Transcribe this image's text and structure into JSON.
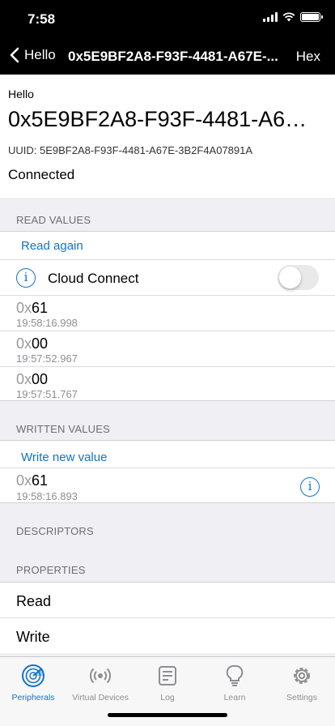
{
  "status": {
    "time": "7:58"
  },
  "nav": {
    "back_label": "Hello",
    "title": "0x5E9BF2A8-F93F-4481-A67E-...",
    "right_label": "Hex"
  },
  "header": {
    "peripheral_name": "Hello",
    "characteristic_title": "0x5E9BF2A8-F93F-4481-A6…",
    "uuid": "UUID: 5E9BF2A8-F93F-4481-A67E-3B2F4A07891A",
    "status": "Connected"
  },
  "read_values": {
    "section_title": "READ VALUES",
    "read_again": "Read again",
    "cloud_connect": {
      "label": "Cloud Connect",
      "enabled": false
    },
    "items": [
      {
        "prefix": "0x",
        "value": "61",
        "timestamp": "19:58:16.998"
      },
      {
        "prefix": "0x",
        "value": "00",
        "timestamp": "19:57:52.967"
      },
      {
        "prefix": "0x",
        "value": "00",
        "timestamp": "19:57:51.767"
      }
    ]
  },
  "written_values": {
    "section_title": "WRITTEN VALUES",
    "write_new": "Write new value",
    "items": [
      {
        "prefix": "0x",
        "value": "61",
        "timestamp": "19:58:16.893"
      }
    ]
  },
  "descriptors": {
    "section_title": "DESCRIPTORS"
  },
  "properties": {
    "section_title": "PROPERTIES",
    "items": [
      "Read",
      "Write"
    ]
  },
  "tabs": [
    {
      "label": "Peripherals",
      "icon": "radar-icon",
      "active": true
    },
    {
      "label": "Virtual Devices",
      "icon": "broadcast-icon",
      "active": false
    },
    {
      "label": "Log",
      "icon": "log-icon",
      "active": false
    },
    {
      "label": "Learn",
      "icon": "lightbulb-icon",
      "active": false
    },
    {
      "label": "Settings",
      "icon": "gear-icon",
      "active": false
    }
  ],
  "colors": {
    "accent": "#1273c8",
    "nav_bg": "#000000",
    "page_bg": "#efeff4"
  }
}
